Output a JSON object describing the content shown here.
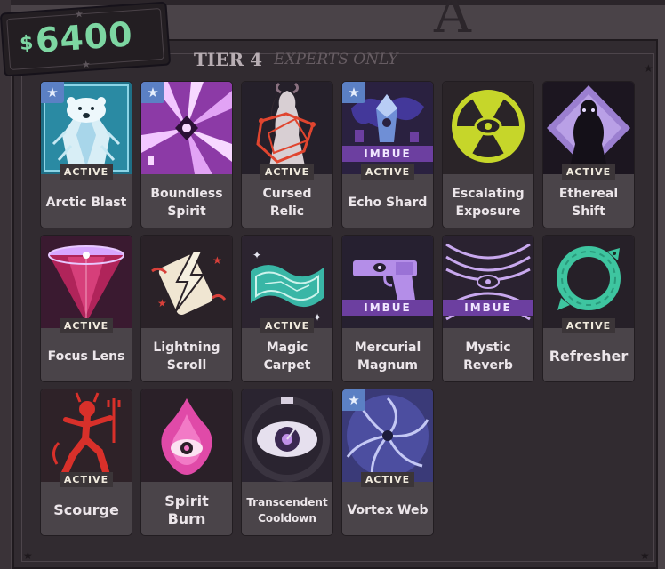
{
  "money": {
    "symbol": "$",
    "value": "6400"
  },
  "tier": {
    "title": "TIER 4",
    "subtitle": "EXPERTS ONLY"
  },
  "labels": {
    "active": "ACTIVE",
    "imbue": "IMBUE",
    "starred": "★"
  },
  "colors": {
    "money": "#7dd6a2",
    "imbue": "#6c3fa0",
    "star_badge": "#5b80c4",
    "card_bg": "#4a4449"
  },
  "items": [
    {
      "name": "Arctic Blast",
      "icon": "polar-bear-icon",
      "starred": true,
      "active": true,
      "imbue": false
    },
    {
      "name": "Boundless Spirit",
      "icon": "spirit-burst-icon",
      "starred": true,
      "active": false,
      "imbue": false
    },
    {
      "name": "Cursed Relic",
      "icon": "cursed-figure-icon",
      "starred": false,
      "active": true,
      "imbue": false
    },
    {
      "name": "Echo Shard",
      "icon": "crystal-shard-icon",
      "starred": true,
      "active": true,
      "imbue": true
    },
    {
      "name": "Escalating Exposure",
      "icon": "radiation-eye-icon",
      "starred": false,
      "active": false,
      "imbue": false
    },
    {
      "name": "Ethereal Shift",
      "icon": "shadow-figure-icon",
      "starred": false,
      "active": true,
      "imbue": false
    },
    {
      "name": "Focus Lens",
      "icon": "focus-cone-icon",
      "starred": false,
      "active": true,
      "imbue": false
    },
    {
      "name": "Lightning Scroll",
      "icon": "lightning-scroll-icon",
      "starred": false,
      "active": false,
      "imbue": false
    },
    {
      "name": "Magic Carpet",
      "icon": "magic-carpet-icon",
      "starred": false,
      "active": true,
      "imbue": false
    },
    {
      "name": "Mercurial Magnum",
      "icon": "pistol-icon",
      "starred": false,
      "active": false,
      "imbue": true
    },
    {
      "name": "Mystic Reverb",
      "icon": "sound-wave-eye-icon",
      "starred": false,
      "active": false,
      "imbue": true
    },
    {
      "name": "Refresher",
      "icon": "serpent-ring-icon",
      "starred": false,
      "active": true,
      "imbue": false
    },
    {
      "name": "Scourge",
      "icon": "devil-icon",
      "starred": false,
      "active": true,
      "imbue": false
    },
    {
      "name": "Spirit Burn",
      "icon": "flaming-eye-icon",
      "starred": false,
      "active": false,
      "imbue": false
    },
    {
      "name": "Transcendent Cooldown",
      "icon": "eye-timer-icon",
      "starred": false,
      "active": false,
      "imbue": false
    },
    {
      "name": "Vortex Web",
      "icon": "vortex-web-icon",
      "starred": true,
      "active": true,
      "imbue": false
    }
  ]
}
